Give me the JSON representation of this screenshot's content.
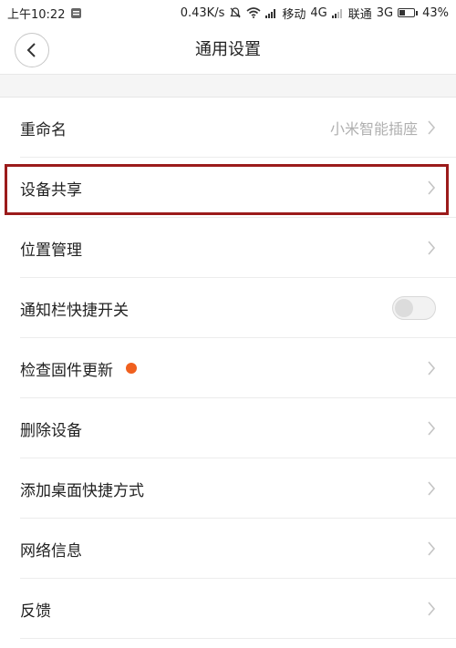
{
  "status_bar": {
    "time": "上午10:22",
    "net_speed": "0.43K/s",
    "carrier1": "移动",
    "network1": "4G",
    "carrier2": "联通",
    "network2": "3G",
    "battery_percent": "43%",
    "battery_level": 0.43,
    "icons": [
      "notification-icon",
      "mute-icon",
      "wifi-icon",
      "signal-icon",
      "battery-icon"
    ]
  },
  "header": {
    "title": "通用设置",
    "back_icon": "back-chevron-icon"
  },
  "settings": [
    {
      "label": "重命名",
      "value": "小米智能插座",
      "control": "chevron"
    },
    {
      "label": "设备共享",
      "value": "",
      "control": "chevron"
    },
    {
      "label": "位置管理",
      "value": "",
      "control": "chevron"
    },
    {
      "label": "通知栏快捷开关",
      "value": "",
      "control": "toggle",
      "toggle_on": false
    },
    {
      "label": "检查固件更新",
      "value": "",
      "control": "chevron",
      "badge": true
    },
    {
      "label": "删除设备",
      "value": "",
      "control": "chevron"
    },
    {
      "label": "添加桌面快捷方式",
      "value": "",
      "control": "chevron"
    },
    {
      "label": "网络信息",
      "value": "",
      "control": "chevron"
    },
    {
      "label": "反馈",
      "value": "",
      "control": "chevron"
    }
  ],
  "colors": {
    "highlight_border": "#9b1b1b",
    "badge": "#f0601e",
    "value_text": "#b0b0b0"
  }
}
